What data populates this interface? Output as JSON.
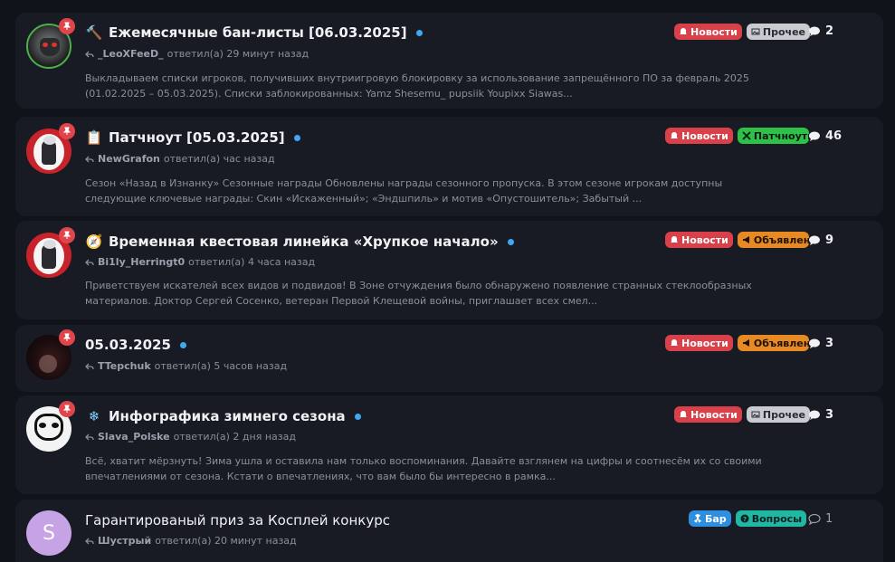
{
  "colors": {
    "background": "#11131a",
    "card": "#191b24",
    "accent": "#3ea8f2",
    "pin": "#e0454b"
  },
  "topics": [
    {
      "emoji": "🔨",
      "title": "Ежемесячные бан-листы [06.03.2025]",
      "user": "_LeoXFeeD_",
      "meta": "ответил(а) 29 минут назад",
      "excerpt": "Выкладываем списки игроков, получивших внутриигровую блокировку за использование запрещённого ПО за февраль 2025 (01.02.2025 – 05.03.2025). Списки заблокированных: Yamz Shesemu_ pupsiik Youpixx Siawas...",
      "tags": [
        {
          "label": "Новости",
          "icon": "bell-icon"
        },
        {
          "label": "Прочее",
          "icon": "image-icon"
        }
      ],
      "replies": "2"
    },
    {
      "emoji": "📋",
      "title": "Патчноут [05.03.2025]",
      "user": "NewGrafon",
      "meta": "ответил(а) час назад",
      "excerpt": "Сезон «Назад в Изнанку» Сезонные награды Обновлены награды сезонного пропуска. В этом сезоне игрокам доступны следующие ключевые награды: Скин «Искаженный»; «Эндшпиль» и мотив «Опустошитель»; Забытый ...",
      "tags": [
        {
          "label": "Новости",
          "icon": "bell-icon"
        },
        {
          "label": "Патчноуты",
          "icon": "tools-icon"
        }
      ],
      "replies": "46"
    },
    {
      "emoji": "🧭",
      "title": "Временная квестовая линейка «Хрупкое начало»",
      "user": "Bi1ly_Herringt0",
      "meta": "ответил(а) 4 часа назад",
      "excerpt": "Приветствуем искателей всех видов и подвидов! В Зоне отчуждения было обнаружено появление странных стеклообразных материалов. Доктор Сергей Сосенко, ветеран Первой Клещевой войны, приглашает всех смел...",
      "tags": [
        {
          "label": "Новости",
          "icon": "bell-icon"
        },
        {
          "label": "Объявления",
          "icon": "megaphone-icon"
        }
      ],
      "replies": "9"
    },
    {
      "emoji": "",
      "title": "05.03.2025",
      "user": "TTepchuk",
      "meta": "ответил(а) 5 часов назад",
      "excerpt": "",
      "tags": [
        {
          "label": "Новости",
          "icon": "bell-icon"
        },
        {
          "label": "Объявления",
          "icon": "megaphone-icon"
        }
      ],
      "replies": "3"
    },
    {
      "emoji": "❄",
      "title": "Инфографика зимнего сезона",
      "user": "Slava_Polske",
      "meta": "ответил(а) 2 дня назад",
      "excerpt": "Всё, хватит мёрзнуть! Зима ушла и оставила нам только воспоминания. Давайте взглянем на цифры и соотнесём их со своими впечатлениями от сезона. Кстати о впечатлениях, что вам было бы интересно в рамка...",
      "tags": [
        {
          "label": "Новости",
          "icon": "bell-icon"
        },
        {
          "label": "Прочее",
          "icon": "image-icon"
        }
      ],
      "replies": "3"
    },
    {
      "emoji": "",
      "title": "Гарантированый приз за Косплей конкурс",
      "user": "Шустрый",
      "meta": "ответил(а) 20 минут назад",
      "avatar_letter": "S",
      "excerpt": "",
      "tags": [
        {
          "label": "Бар",
          "icon": "radiation-icon"
        },
        {
          "label": "Вопросы",
          "icon": "question-icon"
        }
      ],
      "replies": "1"
    }
  ]
}
